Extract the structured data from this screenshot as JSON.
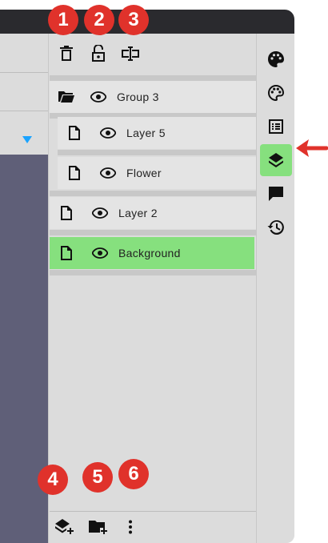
{
  "toolbar": {
    "icons": [
      "trash-icon",
      "unlock-icon",
      "text-cursor-icon"
    ]
  },
  "layers": [
    {
      "label": "Group 3",
      "type": "folder",
      "visible": true,
      "level": 0,
      "selected": false
    },
    {
      "label": "Layer 5",
      "type": "file",
      "visible": true,
      "level": 1,
      "selected": false
    },
    {
      "label": "Flower",
      "type": "file",
      "visible": true,
      "level": 1,
      "selected": false
    },
    {
      "label": "Layer 2",
      "type": "file",
      "visible": true,
      "level": 0,
      "selected": false
    },
    {
      "label": "Background",
      "type": "file",
      "visible": true,
      "level": 0,
      "selected": true
    }
  ],
  "bottom_bar": {
    "icons": [
      "add-layer-icon",
      "add-folder-icon",
      "more-vertical-icon"
    ]
  },
  "rail": {
    "icons": [
      "palette-filled-icon",
      "palette-outline-icon",
      "list-icon",
      "layers-icon",
      "comment-icon",
      "history-icon"
    ],
    "active": "layers-icon"
  },
  "callouts": [
    "1",
    "2",
    "3",
    "4",
    "5",
    "6"
  ],
  "colors": {
    "selected": "#86e07e",
    "badge": "#e0322b",
    "canvas": "#5f5f78",
    "panel": "#dcdcdc"
  }
}
